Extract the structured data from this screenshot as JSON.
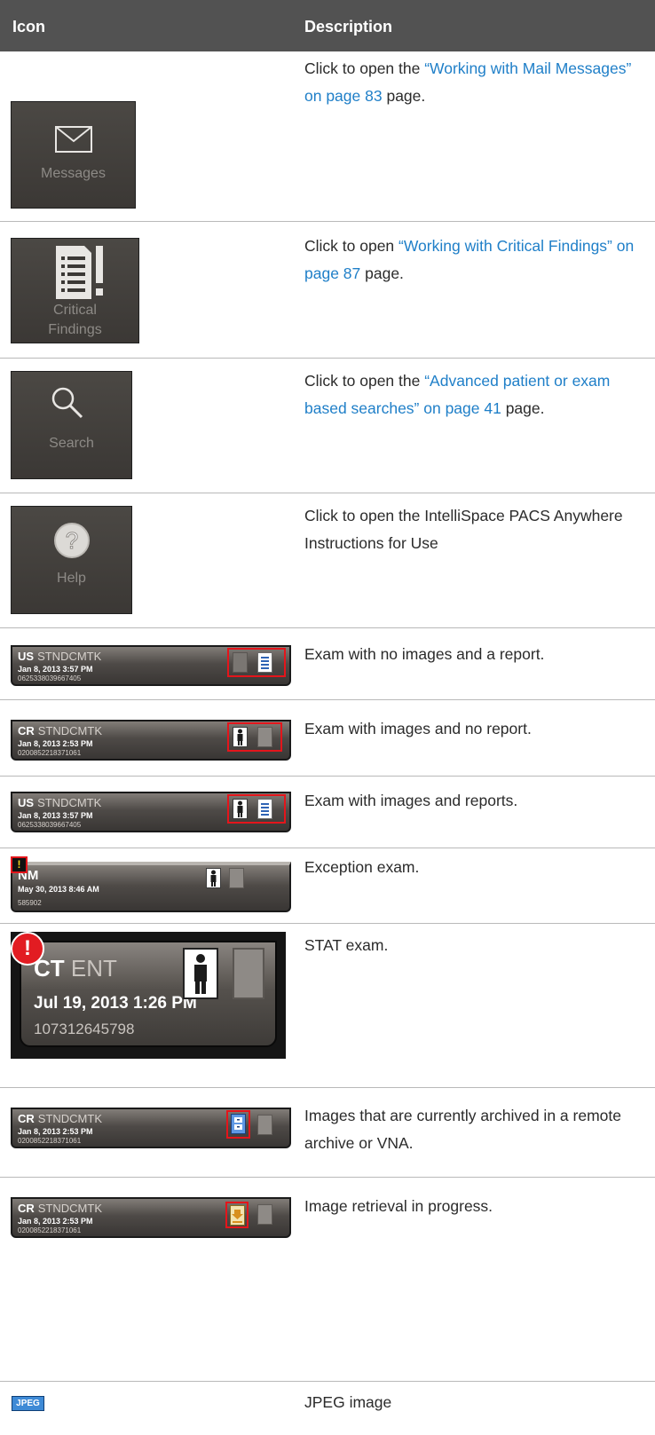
{
  "header": {
    "col_icon": "Icon",
    "col_desc": "Description"
  },
  "rows": {
    "messages": {
      "icon_label": "Messages",
      "pre": "Click to open the ",
      "link": "“Working with Mail Messages” on page 83",
      "post": " page."
    },
    "critical": {
      "icon_label_1": "Critical",
      "icon_label_2": "Findings",
      "pre": "Click to open ",
      "link": "“Working with Critical Findings” on page 87",
      "post": " page."
    },
    "search": {
      "icon_label": "Search",
      "pre": "Click to open the ",
      "link": "“Advanced patient or exam based searches” on page 41",
      "post": " page."
    },
    "help": {
      "icon_label": "Help",
      "text": "Click to open the IntelliSpace PACS Anywhere Instructions for Use"
    },
    "no_images_report": {
      "modality": "US",
      "location": "STNDCMTK",
      "datetime": "Jan 8, 2013 3:57 PM",
      "accession": "0625338039667405",
      "text": "Exam with no images and a report."
    },
    "images_no_report": {
      "modality": "CR",
      "location": "STNDCMTK",
      "datetime": "Jan 8, 2013 2:53 PM",
      "accession": "0200852218371061",
      "text": "Exam with images and no report."
    },
    "images_reports": {
      "modality": "US",
      "location": "STNDCMTK",
      "datetime": "Jan 8, 2013 3:57 PM",
      "accession": "0625338039667405",
      "text": "Exam with images and reports."
    },
    "exception": {
      "modality": "NM",
      "datetime": "May 30, 2013 8:46 AM",
      "accession": "585902",
      "text": "Exception exam."
    },
    "stat": {
      "modality": "CT",
      "location": "ENT",
      "datetime": "Jul 19, 2013 1:26 PM",
      "accession": "107312645798",
      "text": "STAT exam."
    },
    "archived": {
      "modality": "CR",
      "location": "STNDCMTK",
      "datetime": "Jan 8, 2013 2:53 PM",
      "accession": "0200852218371061",
      "text": "Images that are currently archived in a remote archive or VNA."
    },
    "retrieval": {
      "modality": "CR",
      "location": "STNDCMTK",
      "datetime": "Jan 8, 2013 2:53 PM",
      "accession": "0200852218371061",
      "text": "Image retrieval in progress."
    },
    "jpeg": {
      "icon_label": "JPEG",
      "text": "JPEG image"
    }
  },
  "colors": {
    "link": "#1f7fc8",
    "highlight": "#e4151b",
    "header_bg": "#525252"
  }
}
